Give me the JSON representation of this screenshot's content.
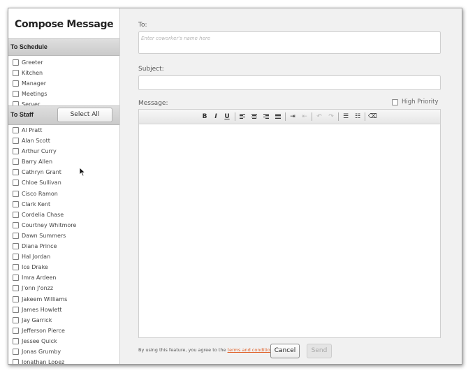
{
  "sidebar": {
    "title": "Compose Message",
    "schedule_header": "To Schedule",
    "schedule_items": [
      {
        "label": "Greeter"
      },
      {
        "label": "Kitchen"
      },
      {
        "label": "Manager"
      },
      {
        "label": "Meetings"
      },
      {
        "label": "Server"
      }
    ],
    "staff_header": "To Staff",
    "select_all_label": "Select All",
    "staff_items": [
      {
        "label": "Al Pratt"
      },
      {
        "label": "Alan Scott"
      },
      {
        "label": "Arthur Curry"
      },
      {
        "label": "Barry Allen"
      },
      {
        "label": "Cathryn Grant"
      },
      {
        "label": "Chloe Sullivan"
      },
      {
        "label": "Cisco Ramon"
      },
      {
        "label": "Clark Kent"
      },
      {
        "label": "Cordelia Chase"
      },
      {
        "label": "Courtney Whitmore"
      },
      {
        "label": "Dawn Summers"
      },
      {
        "label": "Diana Prince"
      },
      {
        "label": "Hal Jordan"
      },
      {
        "label": "Ice Drake"
      },
      {
        "label": "Imra Ardeen"
      },
      {
        "label": "J'onn J'onzz"
      },
      {
        "label": "Jakeem Williams"
      },
      {
        "label": "James Howlett"
      },
      {
        "label": "Jay Garrick"
      },
      {
        "label": "Jefferson Pierce"
      },
      {
        "label": "Jessee Quick"
      },
      {
        "label": "Jonas Grumby"
      },
      {
        "label": "Jonathan Lopez"
      }
    ]
  },
  "main": {
    "to_label": "To:",
    "to_placeholder": "Enter coworker's name here",
    "to_value": "",
    "subject_label": "Subject:",
    "subject_value": "",
    "message_label": "Message:",
    "high_priority_label": "High Priority",
    "message_value": "",
    "toolbar": [
      {
        "icon": "bold-icon",
        "glyph": "B"
      },
      {
        "icon": "italic-icon",
        "glyph": "I"
      },
      {
        "icon": "underline-icon",
        "glyph": "U"
      },
      {
        "icon": "align-left-icon"
      },
      {
        "icon": "align-center-icon"
      },
      {
        "icon": "align-right-icon"
      },
      {
        "icon": "align-justify-icon"
      },
      {
        "icon": "indent-icon"
      },
      {
        "icon": "outdent-icon"
      },
      {
        "icon": "undo-icon"
      },
      {
        "icon": "redo-icon"
      },
      {
        "icon": "bulleted-list-icon"
      },
      {
        "icon": "numbered-list-icon"
      },
      {
        "icon": "eraser-icon"
      }
    ],
    "footer_text": "By using this feature, you agree to the",
    "terms_link": "terms and conditions",
    "cancel_label": "Cancel",
    "send_label": "Send"
  },
  "colors": {
    "link": "#e0632c",
    "section_header_bg": "#d4d4d4",
    "background": "#f1f1f1"
  }
}
